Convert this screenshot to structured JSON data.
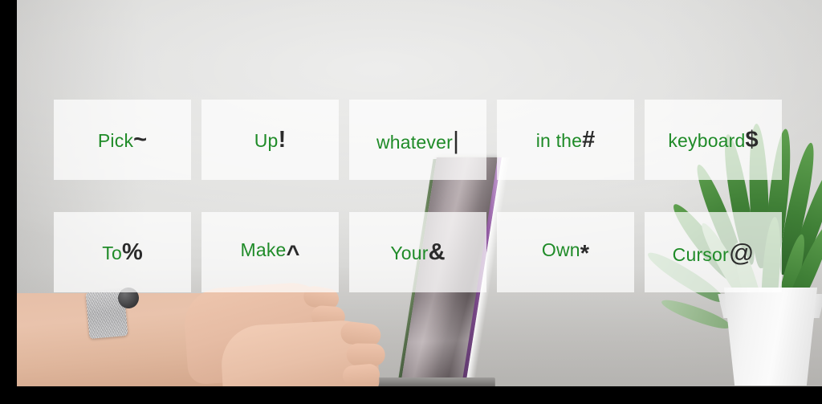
{
  "scene": {
    "description": "photo-of-desk-with-laptop-hands-and-plant",
    "background_objects": [
      {
        "name": "wall",
        "color": "#d8d8d6"
      },
      {
        "name": "laptop",
        "color": "#9a9094"
      },
      {
        "name": "hands",
        "color": "#e8c0a8"
      },
      {
        "name": "wristwatch",
        "color": "#bcbcbe"
      },
      {
        "name": "succulent-plant",
        "color": "#3f7f36"
      },
      {
        "name": "flower-pot",
        "color": "#f4f4f4"
      }
    ]
  },
  "colors": {
    "word_green": "#1f8b28",
    "symbol_dark": "#2b2b2b",
    "tile_overlay": "rgba(255,255,255,0.72)",
    "letterbox": "#000000"
  },
  "overlay": {
    "rows": 2,
    "columns": 5,
    "tiles": [
      {
        "id": "tile-1",
        "word": "Pick",
        "symbol": "~",
        "symbol_style": "bold"
      },
      {
        "id": "tile-2",
        "word": "Up",
        "symbol": "!",
        "symbol_style": "bold"
      },
      {
        "id": "tile-3",
        "word": "whatever",
        "symbol": "|",
        "symbol_style": "thin"
      },
      {
        "id": "tile-4",
        "word": "in the",
        "symbol": "#",
        "symbol_style": "bold"
      },
      {
        "id": "tile-5",
        "word": "keyboard",
        "symbol": "$",
        "symbol_style": "bold"
      },
      {
        "id": "tile-6",
        "word": "To",
        "symbol": "%",
        "symbol_style": "bold"
      },
      {
        "id": "tile-7",
        "word": "Make",
        "symbol": "^",
        "symbol_style": "bold-raised"
      },
      {
        "id": "tile-8",
        "word": "Your",
        "symbol": "&",
        "symbol_style": "bold"
      },
      {
        "id": "tile-9",
        "word": "Own",
        "symbol": "*",
        "symbol_style": "bold-raised"
      },
      {
        "id": "tile-10",
        "word": "Cursor",
        "symbol": "@",
        "symbol_style": "thin"
      }
    ],
    "full_phrase": "Pick ~ Up ! whatever | in the # keyboard $ To % Make ^ Your & Own * Cursor @"
  }
}
